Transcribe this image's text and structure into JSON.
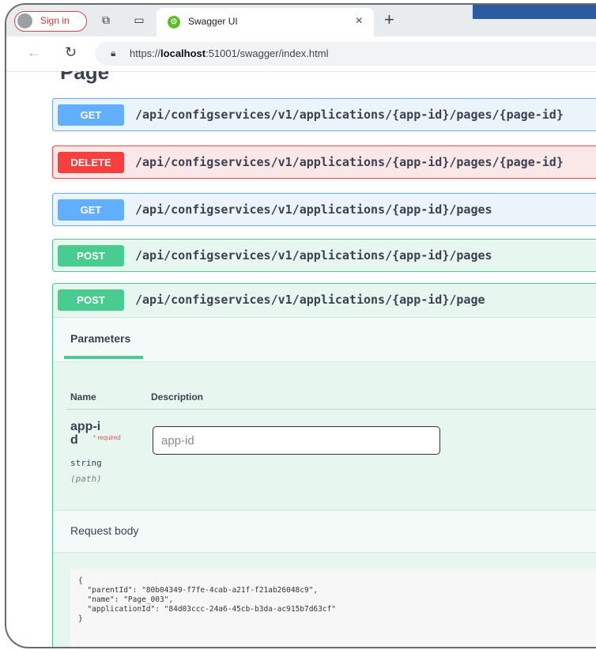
{
  "browser": {
    "signin_label": "Sign in",
    "tab_title": "Swagger UI",
    "tab_close": "×",
    "new_tab": "+",
    "url_prefix": "https://",
    "url_host": "localhost",
    "url_rest": ":51001/swagger/index.html"
  },
  "section": {
    "title": "Page"
  },
  "operations": [
    {
      "method": "GET",
      "path": "/api/configservices/v1/applications/{app-id}/pages/{page-id}"
    },
    {
      "method": "DELETE",
      "path": "/api/configservices/v1/applications/{app-id}/pages/{page-id}"
    },
    {
      "method": "GET",
      "path": "/api/configservices/v1/applications/{app-id}/pages"
    },
    {
      "method": "POST",
      "path": "/api/configservices/v1/applications/{app-id}/pages"
    },
    {
      "method": "POST",
      "path": "/api/configservices/v1/applications/{app-id}/page"
    }
  ],
  "expanded": {
    "parameters_tab": "Parameters",
    "col_name": "Name",
    "col_description": "Description",
    "param": {
      "name": "app-id",
      "required_label": "* required",
      "type": "string",
      "location": "(path)",
      "placeholder": "app-id"
    },
    "request_body_label": "Request body",
    "request_body_json": "{\n  \"parentId\": \"80b04349-f7fe-4cab-a21f-f21ab26048c9\",\n  \"name\": \"Page_003\",\n  \"applicationId\": \"84d03ccc-24a6-45cb-b3da-ac915b7d63cf\"\n}"
  },
  "colors": {
    "get": "#61affe",
    "delete": "#f93e3e",
    "post": "#49cc90"
  },
  "icons": {
    "avatar": "person-avatar-icon",
    "collections": "collections-icon",
    "tab_actions": "tab-actions-icon",
    "favicon": "swagger-favicon-icon",
    "reload": "reload-icon",
    "back": "back-arrow-icon",
    "lock": "lock-icon"
  }
}
